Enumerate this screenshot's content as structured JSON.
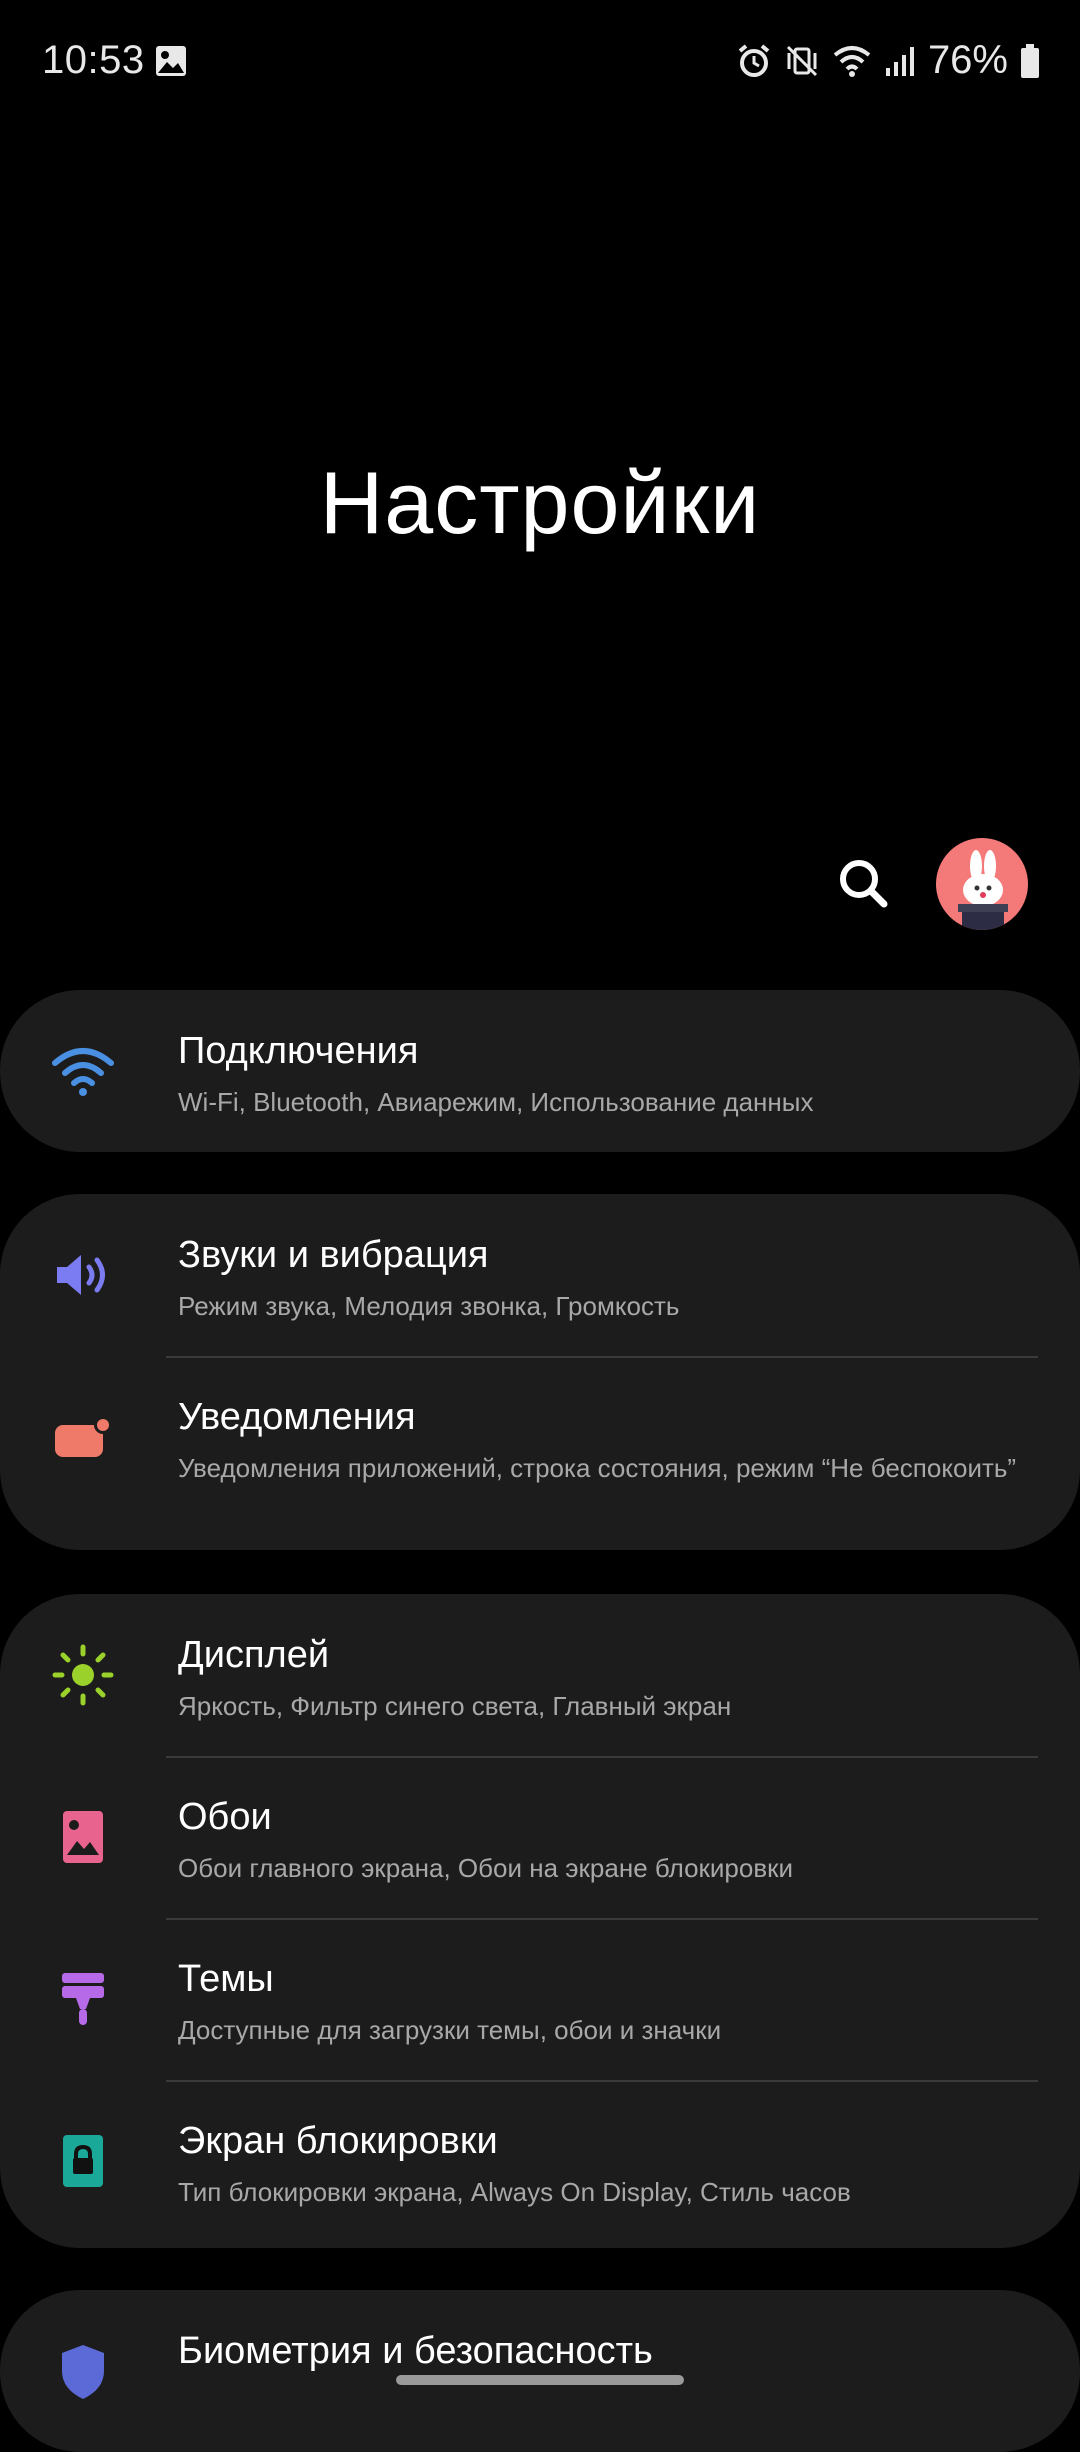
{
  "status_bar": {
    "time": "10:53",
    "battery": "76%"
  },
  "header": {
    "title": "Настройки"
  },
  "groups": [
    {
      "items": [
        {
          "title": "Подключения",
          "subtitle": "Wi-Fi, Bluetooth, Авиарежим, Использование данных",
          "icon": "wifi-icon",
          "color": "#4a90e2"
        }
      ]
    },
    {
      "items": [
        {
          "title": "Звуки и вибрация",
          "subtitle": "Режим звука, Мелодия звонка, Громкость",
          "icon": "volume-icon",
          "color": "#7b7bf2"
        },
        {
          "title": "Уведомления",
          "subtitle": "Уведомления приложений, строка состояния, режим “Не беспокоить”",
          "icon": "notification-icon",
          "color": "#f07a6a"
        }
      ]
    },
    {
      "items": [
        {
          "title": "Дисплей",
          "subtitle": "Яркость, Фильтр синего света, Главный экран",
          "icon": "brightness-icon",
          "color": "#9ad12a"
        },
        {
          "title": "Обои",
          "subtitle": "Обои главного экрана, Обои на экране блокировки",
          "icon": "wallpaper-icon",
          "color": "#e8648f"
        },
        {
          "title": "Темы",
          "subtitle": "Доступные для загрузки темы, обои и значки",
          "icon": "themes-icon",
          "color": "#b76ae8"
        },
        {
          "title": "Экран блокировки",
          "subtitle": "Тип блокировки экрана, Always On Display, Стиль часов",
          "icon": "lock-icon",
          "color": "#1aa898"
        }
      ]
    },
    {
      "items": [
        {
          "title": "Биометрия и безопасность",
          "icon": "shield-icon",
          "color": "#5b6ad6"
        }
      ]
    }
  ]
}
